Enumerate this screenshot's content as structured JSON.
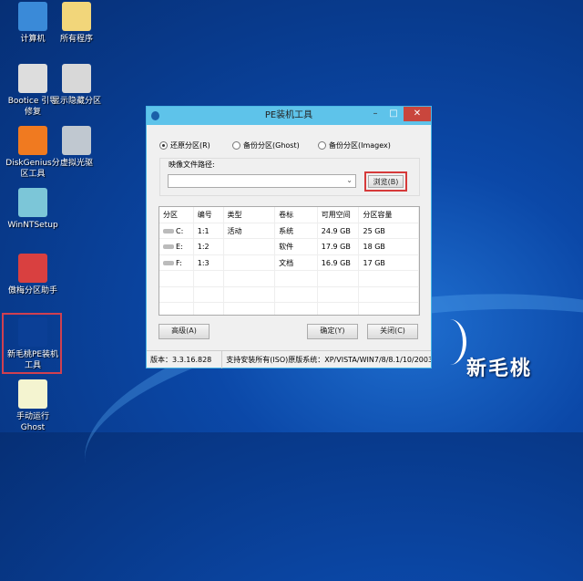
{
  "desktop": {
    "icons": [
      {
        "label": "计算机",
        "color": "#3a8ad8"
      },
      {
        "label": "所有程序",
        "color": "#f2d67a"
      },
      {
        "label": "Bootice 引导修复",
        "color": "#dddddd"
      },
      {
        "label": "显示隐藏分区",
        "color": "#d8d8d8"
      },
      {
        "label": "DiskGenius分区工具",
        "color": "#f07a20"
      },
      {
        "label": "虚拟光驱",
        "color": "#c0c8d0"
      },
      {
        "label": "WinNTSetup",
        "color": "#7cc6d8"
      },
      {
        "label": "傲梅分区助手",
        "color": "#d94040"
      },
      {
        "label": "新毛桃PE装机工具",
        "color": "#0b3f96"
      },
      {
        "label": "手动运行Ghost",
        "color": "#f4f4d0"
      }
    ],
    "brand": "新毛桃"
  },
  "window": {
    "title": "PE装机工具",
    "minimize": "–",
    "maximize": "□",
    "close": "✕",
    "radios": [
      {
        "label": "还原分区(R)",
        "checked": true
      },
      {
        "label": "备份分区(Ghost)",
        "checked": false
      },
      {
        "label": "备份分区(Imagex)",
        "checked": false
      }
    ],
    "path_label": "映像文件路径:",
    "path_value": "",
    "browse": "浏览(B)",
    "columns": [
      "分区",
      "编号",
      "类型",
      "卷标",
      "可用空间",
      "分区容量"
    ],
    "rows": [
      [
        "C:",
        "1:1",
        "活动",
        "系统",
        "24.9 GB",
        "25 GB"
      ],
      [
        "E:",
        "1:2",
        "",
        "软件",
        "17.9 GB",
        "18 GB"
      ],
      [
        "F:",
        "1:3",
        "",
        "文档",
        "16.9 GB",
        "17 GB"
      ]
    ],
    "advanced": "高级(A)",
    "ok": "确定(Y)",
    "cancel": "关闭(C)",
    "version": "版本：3.3.16.828",
    "support": "支持安装所有(ISO)原版系统：XP/VISTA/WIN7/8/8.1/10/2003"
  }
}
